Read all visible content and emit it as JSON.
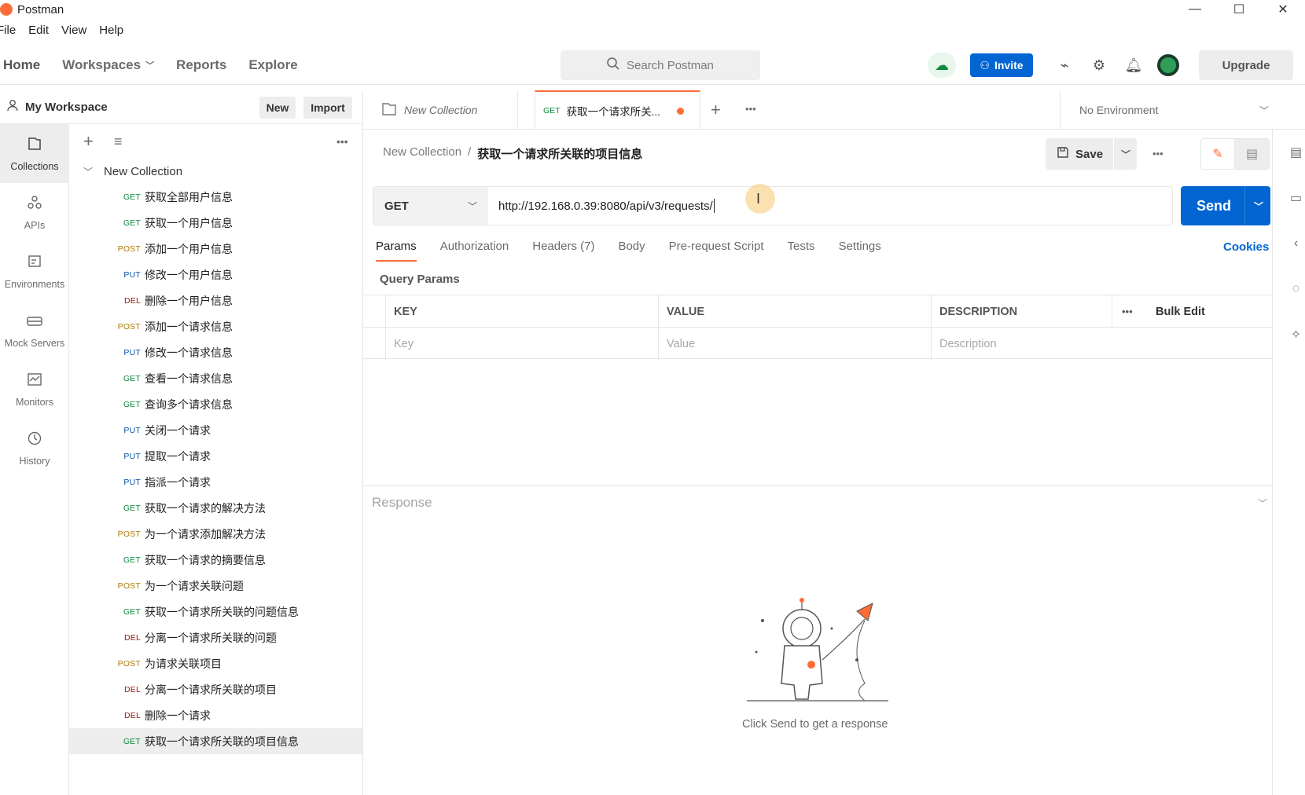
{
  "window": {
    "title": "Postman"
  },
  "menu": [
    "File",
    "Edit",
    "View",
    "Help"
  ],
  "nav": {
    "home": "Home",
    "workspaces": "Workspaces",
    "reports": "Reports",
    "explore": "Explore"
  },
  "search": {
    "placeholder": "Search Postman"
  },
  "header": {
    "invite": "Invite",
    "upgrade": "Upgrade"
  },
  "workspace": {
    "name": "My Workspace",
    "new": "New",
    "import": "Import"
  },
  "rail": [
    {
      "label": "Collections",
      "icon": "collections-icon"
    },
    {
      "label": "APIs",
      "icon": "apis-icon"
    },
    {
      "label": "Environments",
      "icon": "environments-icon"
    },
    {
      "label": "Mock Servers",
      "icon": "mock-servers-icon"
    },
    {
      "label": "Monitors",
      "icon": "monitors-icon"
    },
    {
      "label": "History",
      "icon": "history-icon"
    }
  ],
  "collection": {
    "name": "New Collection",
    "requests": [
      {
        "method": "GET",
        "name": "获取全部用户信息"
      },
      {
        "method": "GET",
        "name": "获取一个用户信息"
      },
      {
        "method": "POST",
        "name": "添加一个用户信息"
      },
      {
        "method": "PUT",
        "name": "修改一个用户信息"
      },
      {
        "method": "DEL",
        "name": "删除一个用户信息"
      },
      {
        "method": "POST",
        "name": "添加一个请求信息"
      },
      {
        "method": "PUT",
        "name": "修改一个请求信息"
      },
      {
        "method": "GET",
        "name": "查看一个请求信息"
      },
      {
        "method": "GET",
        "name": "查询多个请求信息"
      },
      {
        "method": "PUT",
        "name": "关闭一个请求"
      },
      {
        "method": "PUT",
        "name": "提取一个请求"
      },
      {
        "method": "PUT",
        "name": "指派一个请求"
      },
      {
        "method": "GET",
        "name": "获取一个请求的解决方法"
      },
      {
        "method": "POST",
        "name": "为一个请求添加解决方法"
      },
      {
        "method": "GET",
        "name": "获取一个请求的摘要信息"
      },
      {
        "method": "POST",
        "name": "为一个请求关联问题"
      },
      {
        "method": "GET",
        "name": "获取一个请求所关联的问题信息"
      },
      {
        "method": "DEL",
        "name": "分离一个请求所关联的问题"
      },
      {
        "method": "POST",
        "name": "为请求关联项目"
      },
      {
        "method": "DEL",
        "name": "分离一个请求所关联的项目"
      },
      {
        "method": "DEL",
        "name": "删除一个请求"
      },
      {
        "method": "GET",
        "name": "获取一个请求所关联的项目信息"
      }
    ]
  },
  "tabs": {
    "tab1": "New Collection",
    "tab2": {
      "method": "GET",
      "name": "获取一个请求所关..."
    }
  },
  "environment": "No Environment",
  "breadcrumb": {
    "collection": "New Collection",
    "separator": "/",
    "request": "获取一个请求所关联的项目信息"
  },
  "request": {
    "save": "Save",
    "method": "GET",
    "url": "http://192.168.0.39:8080/api/v3/requests/",
    "send": "Send"
  },
  "subtabs": [
    "Params",
    "Authorization",
    "Headers (7)",
    "Body",
    "Pre-request Script",
    "Tests",
    "Settings"
  ],
  "cookies": "Cookies",
  "query_params": {
    "title": "Query Params",
    "headers": [
      "KEY",
      "VALUE",
      "DESCRIPTION"
    ],
    "placeholders": [
      "Key",
      "Value",
      "Description"
    ],
    "bulk_edit": "Bulk Edit"
  },
  "response": {
    "title": "Response",
    "hint": "Click Send to get a response"
  },
  "colors": {
    "accent": "#ff6c37",
    "primary": "#0265d2",
    "get": "#0b8a3c",
    "post": "#ad7a03",
    "put": "#0953a8",
    "del": "#8e1a10"
  }
}
